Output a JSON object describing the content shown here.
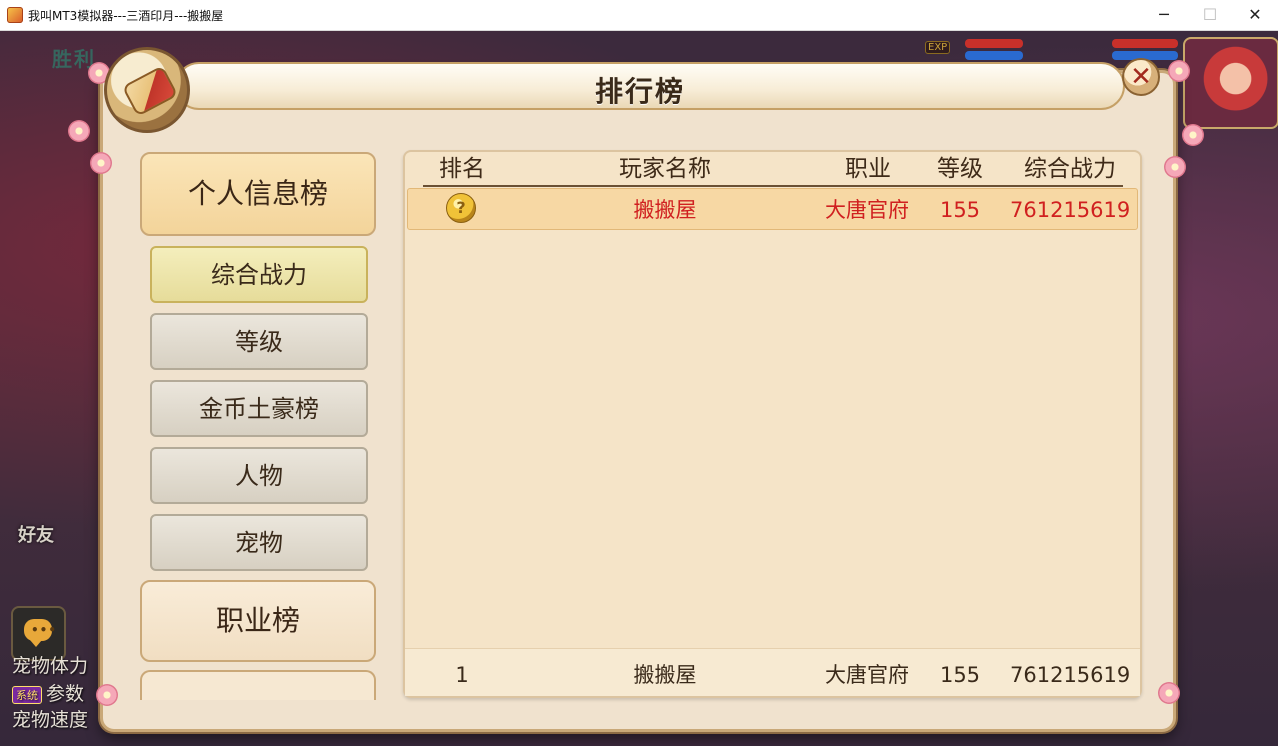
{
  "window": {
    "title": "我叫MT3模拟器---三酒印月---搬搬屋",
    "icon": "app-icon",
    "controls": {
      "minimize": "─",
      "maximize": "☐",
      "close": "✕"
    }
  },
  "background": {
    "top_text": "胜利",
    "exp_label": "EXP",
    "friend_label": "好友",
    "chat_icon": "chat-bubble-icon",
    "chat_dots": "•••",
    "system_lines": [
      {
        "text": "宠物体力"
      },
      {
        "badge": "系统",
        "text": "参数"
      },
      {
        "text": "宠物速度"
      }
    ]
  },
  "panel": {
    "title": "排行榜",
    "close_label": "✕",
    "emblem_icon": "scroll-icon"
  },
  "left_menu": {
    "category_active": "个人信息榜",
    "sub_items": [
      "综合战力",
      "等级",
      "金币土豪榜",
      "人物",
      "宠物"
    ],
    "active_sub_index": 0,
    "category_next": "职业榜"
  },
  "ranking": {
    "columns": [
      "排名",
      "玩家名称",
      "职业",
      "等级",
      "综合战力"
    ],
    "rows": [
      {
        "rank_icon": "gold-medal-icon",
        "rank_glyph": "?",
        "name": "搬搬屋",
        "class": "大唐官府",
        "level": "155",
        "power": "761215619"
      }
    ],
    "self_row": {
      "rank": "1",
      "name": "搬搬屋",
      "class": "大唐官府",
      "level": "155",
      "power": "761215619"
    }
  },
  "colors": {
    "highlight_text": "#d02020",
    "panel_bg": "#f0e2ce",
    "row_highlight": "#f7d8a4"
  }
}
